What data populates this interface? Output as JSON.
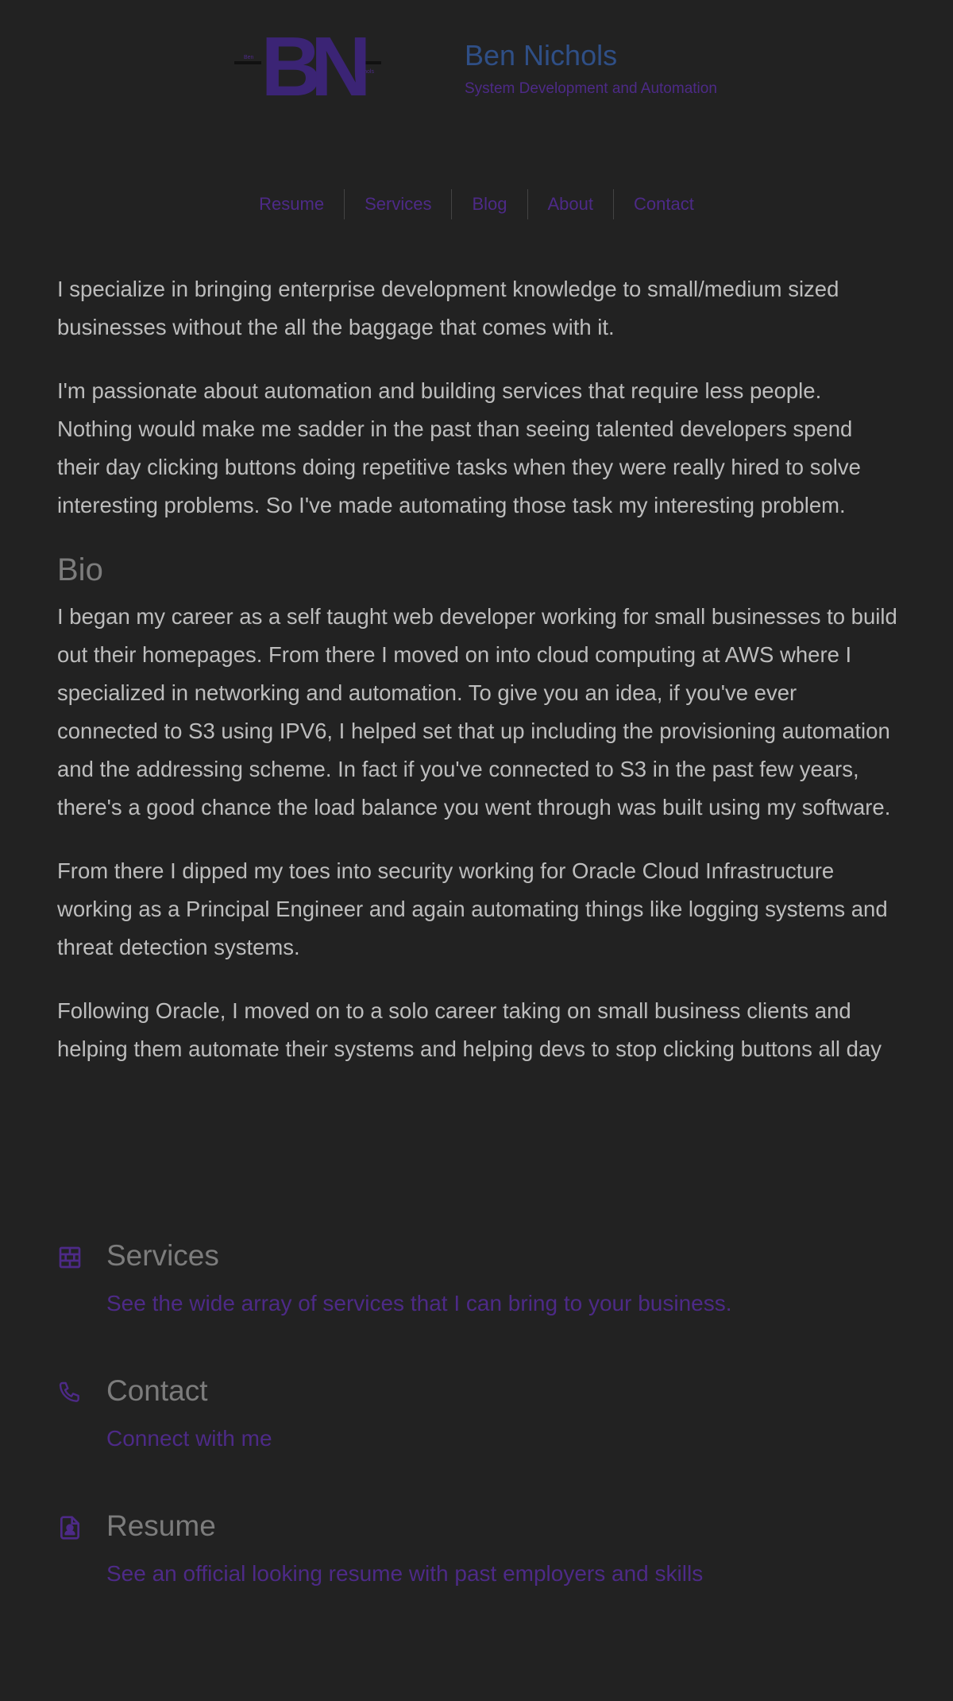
{
  "header": {
    "logo_text": "BN",
    "logo_small_left": "Ben",
    "logo_small_right": "Nichols",
    "title": "Ben Nichols",
    "subtitle": "System Development and Automation"
  },
  "nav": {
    "items": [
      {
        "label": "Resume"
      },
      {
        "label": "Services"
      },
      {
        "label": "Blog"
      },
      {
        "label": "About"
      },
      {
        "label": "Contact"
      }
    ]
  },
  "intro": {
    "p1": "I specialize in bringing enterprise development knowledge to small/medium sized businesses without the all the baggage that comes with it.",
    "p2": "I'm passionate about automation and building services that require less people. Nothing would make me sadder in the past than seeing talented developers spend their day clicking buttons doing repetitive tasks when they were really hired to solve interesting problems. So I've made automating those task my interesting problem."
  },
  "bio": {
    "heading": "Bio",
    "p1": "I began my career as a self taught web developer working for small businesses to build out their homepages. From there I moved on into cloud computing at AWS where I specialized in networking and automation. To give you an idea, if you've ever connected to S3 using IPV6, I helped set that up including the provisioning automation and the addressing scheme. In fact if you've connected to S3 in the past few years, there's a good chance the load balance you went through was built using my software.",
    "p2": "From there I dipped my toes into security working for Oracle Cloud Infrastructure working as a Principal Engineer and again automating things like logging systems and threat detection systems.",
    "p3": "Following Oracle, I moved on to a solo career taking on small business clients and helping them automate their systems and helping devs to stop clicking buttons all day"
  },
  "features": [
    {
      "icon": "brick-wall-icon",
      "title": "Services",
      "desc": "See the wide array of services that I can bring to your business."
    },
    {
      "icon": "phone-icon",
      "title": "Contact",
      "desc": "Connect with me"
    },
    {
      "icon": "file-user-icon",
      "title": "Resume",
      "desc": "See an official looking resume with past employers and skills"
    }
  ],
  "colors": {
    "background": "#222222",
    "accent": "#4d2a87",
    "brand_title": "#2f4f86",
    "body_text": "#bdbdbd",
    "heading_text": "#7c7c7c"
  }
}
